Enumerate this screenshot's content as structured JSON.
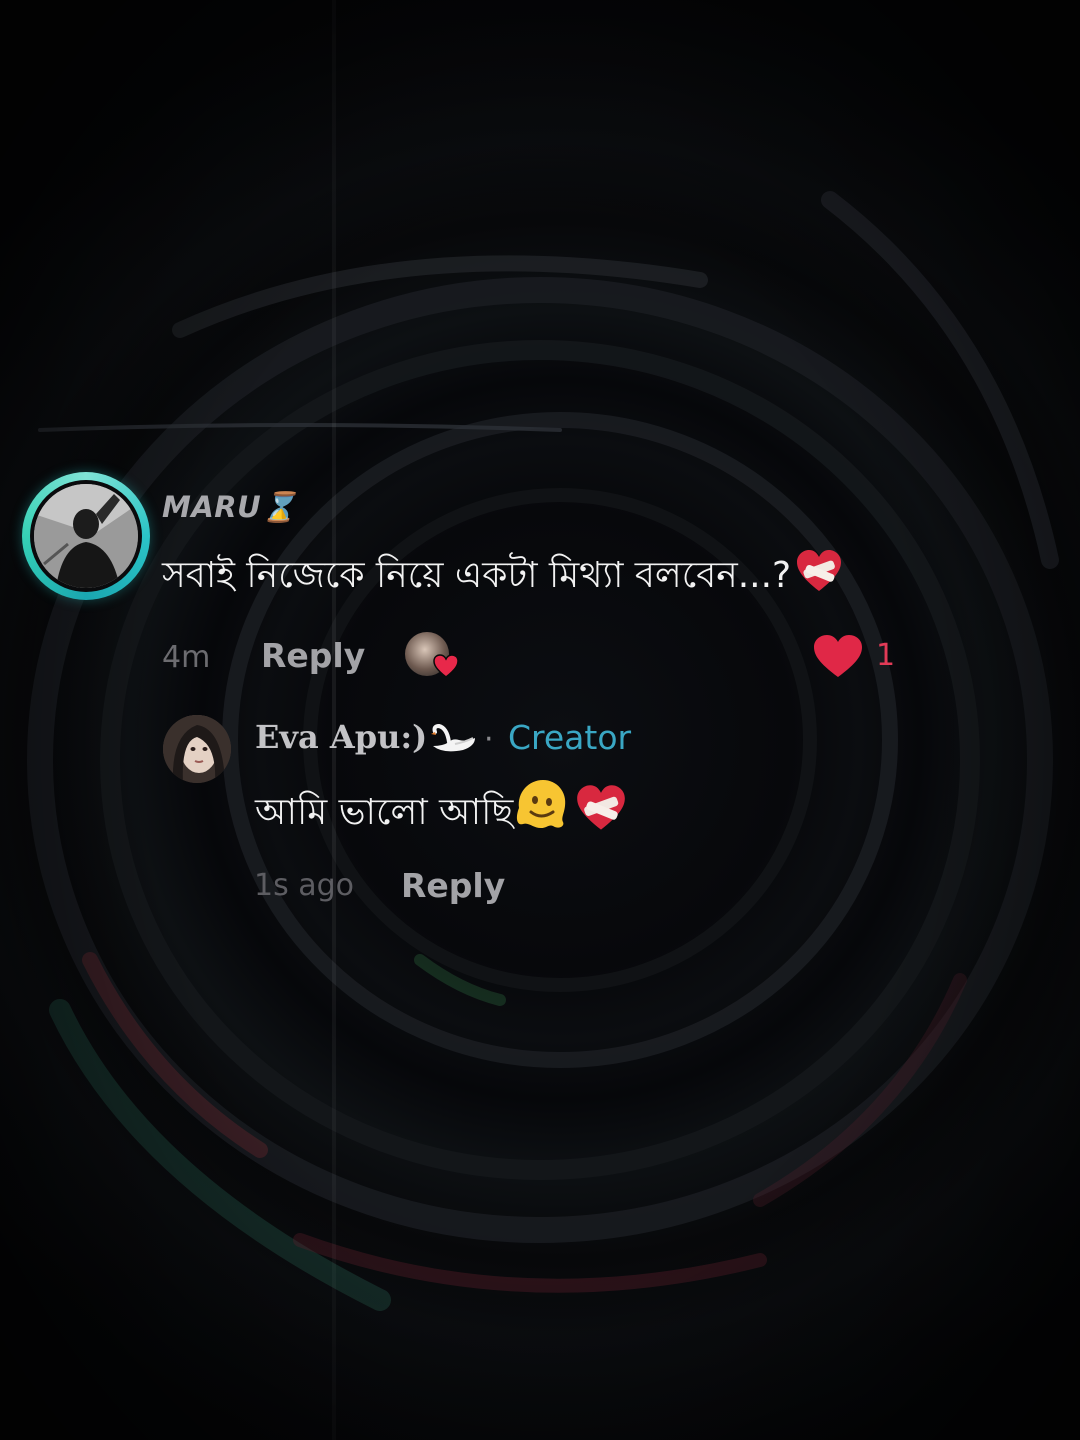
{
  "comment": {
    "username": "MARU⌛",
    "text": "সবাই নিজেকে নিয়ে একটা মিথ্যা বলবেন...?",
    "text_emoji": "mending-heart",
    "time": "4m",
    "reply_label": "Reply",
    "creator_liked": true,
    "like_count": "1",
    "accent_color": "#2bc4c7",
    "like_color": "#e23b57"
  },
  "reply": {
    "username": "Eva Apu:)",
    "name_emoji": "swan",
    "separator": "·",
    "badge": "Creator",
    "text": "আমি ভালো আছি",
    "text_emojis": [
      "melting-face",
      "mending-heart"
    ],
    "time": "1s ago",
    "reply_label": "Reply",
    "badge_color": "#3aa7c4"
  }
}
